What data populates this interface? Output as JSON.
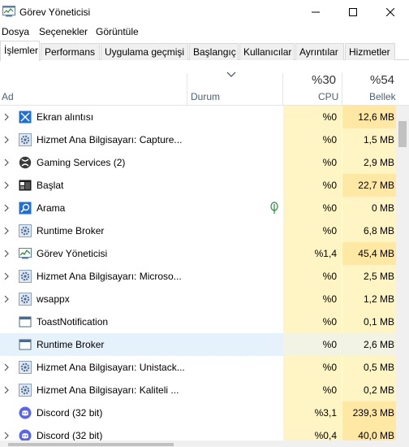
{
  "window": {
    "title": "Görev Yöneticisi",
    "icon": "task-manager-icon"
  },
  "menu": [
    "Dosya",
    "Seçenekler",
    "Görüntüle"
  ],
  "tabs": [
    "İşlemler",
    "Performans",
    "Uygulama geçmişi",
    "Başlangıç",
    "Kullanıcılar",
    "Ayrıntılar",
    "Hizmetler"
  ],
  "active_tab": "İşlemler",
  "columns": {
    "name": "Ad",
    "status": "Durum",
    "cpu_pct": "%30",
    "cpu": "CPU",
    "mem_pct": "%54",
    "mem": "Bellek"
  },
  "processes": [
    {
      "name": "Ekran alıntısı",
      "icon": "snipping-tool-icon",
      "cpu": "%0",
      "mem": "12,6 MB",
      "expandable": true
    },
    {
      "name": "Hizmet Ana Bilgisayarı: Capture...",
      "icon": "service-gear-icon",
      "cpu": "%0",
      "mem": "1,5 MB",
      "expandable": true
    },
    {
      "name": "Gaming Services (2)",
      "icon": "xbox-icon",
      "cpu": "%0",
      "mem": "2,9 MB",
      "expandable": true
    },
    {
      "name": "Başlat",
      "icon": "start-window-icon",
      "cpu": "%0",
      "mem": "22,7 MB",
      "expandable": true
    },
    {
      "name": "Arama",
      "icon": "search-icon",
      "cpu": "%0",
      "mem": "0 MB",
      "expandable": true,
      "status_icon": "leaf-suspended-icon"
    },
    {
      "name": "Runtime Broker",
      "icon": "service-gear-icon",
      "cpu": "%0",
      "mem": "6,8 MB",
      "expandable": true
    },
    {
      "name": "Görev Yöneticisi",
      "icon": "task-manager-icon",
      "cpu": "%1,4",
      "mem": "45,4 MB",
      "expandable": true
    },
    {
      "name": "Hizmet Ana Bilgisayarı: Microso...",
      "icon": "service-gear-icon",
      "cpu": "%0",
      "mem": "2,5 MB",
      "expandable": true
    },
    {
      "name": "wsappx",
      "icon": "service-gear-icon",
      "cpu": "%0",
      "mem": "1,2 MB",
      "expandable": true
    },
    {
      "name": "ToastNotification",
      "icon": "window-icon",
      "cpu": "%0",
      "mem": "0,1 MB",
      "expandable": false
    },
    {
      "name": "Runtime Broker",
      "icon": "window-icon",
      "cpu": "%0",
      "mem": "2,6 MB",
      "expandable": false,
      "selected": true
    },
    {
      "name": "Hizmet Ana Bilgisayarı: Unistack...",
      "icon": "service-gear-icon",
      "cpu": "%0",
      "mem": "0,5 MB",
      "expandable": true
    },
    {
      "name": "Hizmet Ana Bilgisayarı: Kaliteli ...",
      "icon": "service-gear-icon",
      "cpu": "%0",
      "mem": "0,2 MB",
      "expandable": true
    },
    {
      "name": "Discord (32 bit)",
      "icon": "discord-icon",
      "cpu": "%3,1",
      "mem": "239,3 MB",
      "expandable": false
    },
    {
      "name": "Discord (32 bit)",
      "icon": "discord-icon",
      "cpu": "%0,4",
      "mem": "40,0 MB",
      "expandable": true
    }
  ],
  "colors": {
    "heat_light": "#fff4c4",
    "heat_medium": "#ffe8a3",
    "selection": "#e5f1fb",
    "header_text": "#4c607a",
    "icon_blue": "#1e6fd9",
    "discord": "#5865f2"
  }
}
